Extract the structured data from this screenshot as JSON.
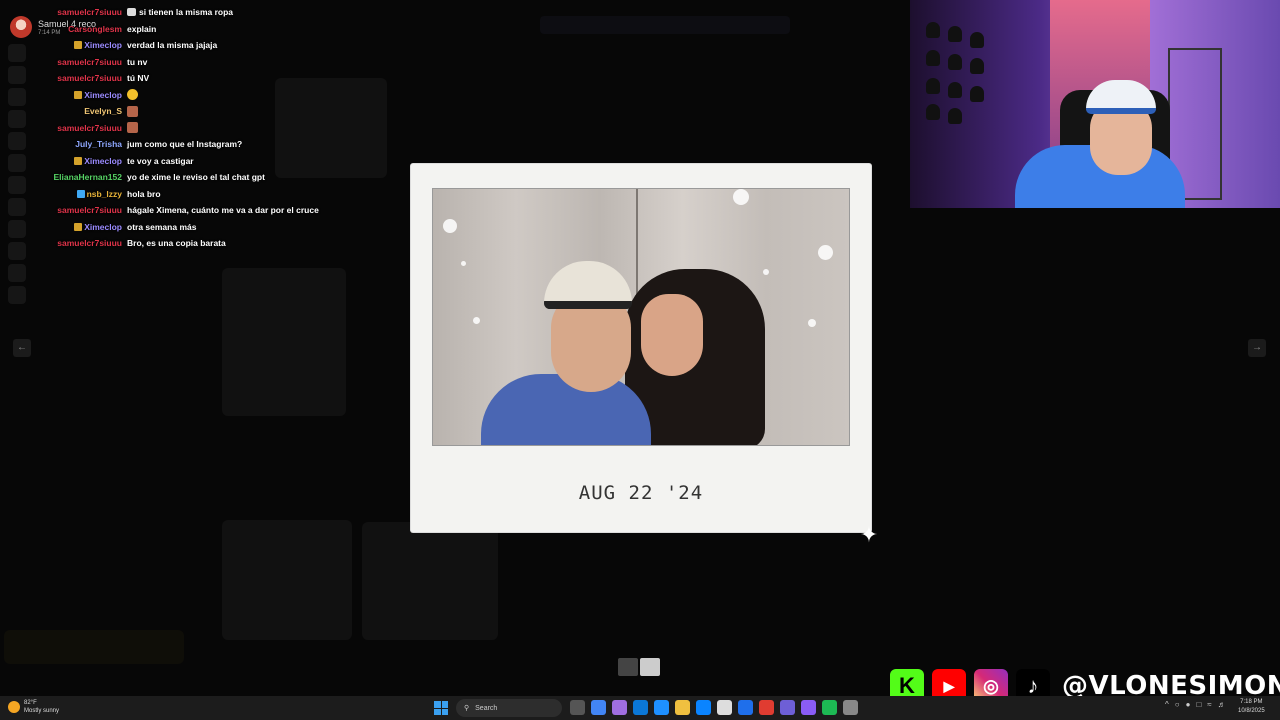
{
  "notification": {
    "name": "Samuel",
    "suffix": "4 reco",
    "time": "7:14 PM"
  },
  "chat": [
    {
      "user": "samuelcr7siuuu",
      "color": "#e0344a",
      "badge": "",
      "text": "si tienen la misma ropa",
      "emote": "box"
    },
    {
      "user": "Carsonglesm",
      "color": "#e0344a",
      "badge": "",
      "text": "explain",
      "emote": ""
    },
    {
      "user": "Ximeclop",
      "color": "#9b8bff",
      "badge": "gold",
      "text": "verdad la misma jajaja",
      "emote": ""
    },
    {
      "user": "samuelcr7siuuu",
      "color": "#e0344a",
      "badge": "",
      "text": "tu nv",
      "emote": ""
    },
    {
      "user": "samuelcr7siuuu",
      "color": "#e0344a",
      "badge": "",
      "text": "tú NV",
      "emote": ""
    },
    {
      "user": "Ximeclop",
      "color": "#9b8bff",
      "badge": "gold",
      "text": "",
      "emote": "face"
    },
    {
      "user": "Evelyn_S",
      "color": "#f0c674",
      "badge": "",
      "text": "",
      "emote": "box"
    },
    {
      "user": "samuelcr7siuuu",
      "color": "#e0344a",
      "badge": "",
      "text": "",
      "emote": "box"
    },
    {
      "user": "July_Trisha",
      "color": "#8fa8ff",
      "badge": "",
      "text": "jum como que el Instagram?",
      "emote": ""
    },
    {
      "user": "Ximeclop",
      "color": "#9b8bff",
      "badge": "gold",
      "text": "te voy a castigar",
      "emote": ""
    },
    {
      "user": "ElianaHernan152",
      "color": "#56d364",
      "badge": "",
      "text": "yo de xime le reviso el tal chat gpt",
      "emote": ""
    },
    {
      "user": "nsb_lzzy",
      "color": "#e8b339",
      "badge": "blue",
      "text": "hola bro",
      "emote": ""
    },
    {
      "user": "samuelcr7siuuu",
      "color": "#e0344a",
      "badge": "",
      "text": "hágale Ximena, cuánto me va a dar por el cruce",
      "emote": ""
    },
    {
      "user": "Ximeclop",
      "color": "#9b8bff",
      "badge": "gold",
      "text": "otra semana más",
      "emote": ""
    },
    {
      "user": "samuelcr7siuuu",
      "color": "#e0344a",
      "badge": "",
      "text": "Bro, es una copia barata",
      "emote": ""
    }
  ],
  "nav": {
    "prev": "←",
    "next": "→"
  },
  "modal": {
    "caption": "AUG 22 '24",
    "sparkle": "✦"
  },
  "socials": {
    "kick": "K",
    "youtube": "▶",
    "instagram": "◎",
    "tiktok": "♪",
    "handle": "@VLONESIMON"
  },
  "taskbar": {
    "weather_temp": "82°F",
    "weather_desc": "Mostly sunny",
    "search_label": "Search",
    "time": "7:18 PM",
    "date": "10/8/2025",
    "apps": [
      "#555",
      "#4285f4",
      "#a06ee0",
      "#0b78d7",
      "#1e90ff",
      "#f0c040",
      "#0a84ff",
      "#ddd",
      "#1f6feb",
      "#e03c31",
      "#6e5fd6",
      "#8a5cf6",
      "#1db954",
      "#888"
    ]
  }
}
